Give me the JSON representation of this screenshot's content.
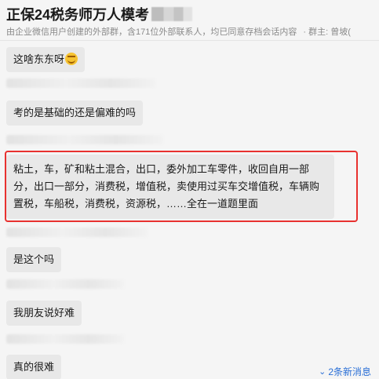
{
  "header": {
    "title": "正保24税务师万人模考",
    "subtitle": "由企业微信用户创建的外部群，含171位外部联系人，均已同意存档会话内容",
    "owner": "· 群主: 曾坡("
  },
  "messages": [
    {
      "text": "这啥东东呀",
      "emoji": "face-with-hand-icon"
    },
    {
      "text": "考的是基础的还是偏难的吗"
    },
    {
      "text": "粘土，车，矿和粘土混合，出口，委外加工车零件，收回自用一部分，出口一部分，消费税，增值税，卖使用过买车交增值税，车辆购置税，车船税，消费税，资源税，……全在一道题里面",
      "highlighted": true
    },
    {
      "text": "是这个吗"
    },
    {
      "text": "我朋友说好难"
    },
    {
      "text": "真的很难"
    }
  ],
  "new_messages_label": "2条新消息",
  "colors": {
    "highlight_border": "#e8312f",
    "bubble_bg": "#e8e8e8",
    "link_blue": "#2a6fd6"
  }
}
